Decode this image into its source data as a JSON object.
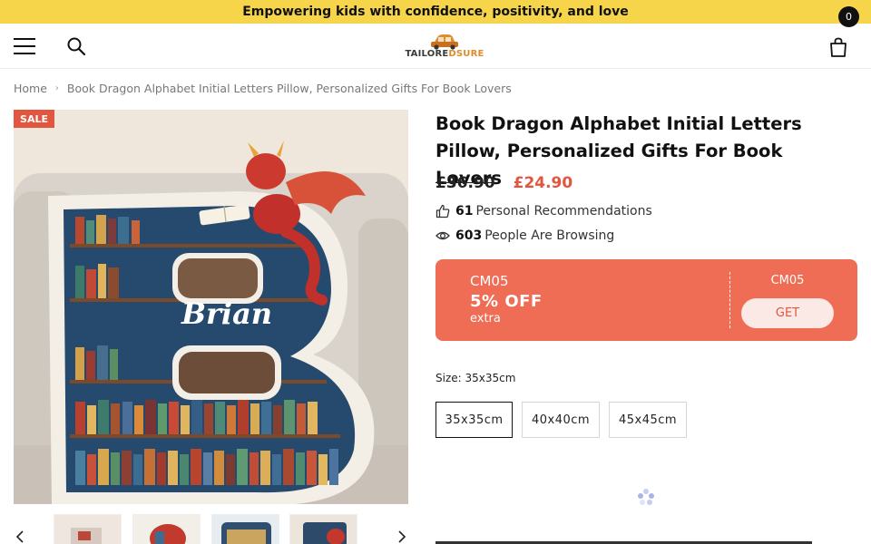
{
  "announcement": "Empowering kids with confidence, positivity, and love",
  "header": {
    "logo_prefix": "TAILORE",
    "logo_suffix": "DSURE",
    "cart_count": "0"
  },
  "breadcrumb": {
    "home": "Home",
    "current": "Book Dragon Alphabet Initial Letters Pillow, Personalized Gifts For Book Lovers"
  },
  "gallery": {
    "badge": "SALE",
    "personalized_name": "Brian"
  },
  "product": {
    "title": "Book Dragon Alphabet Initial Letters Pillow, Personalized Gifts For Book Lovers",
    "old_price": "£36.90",
    "new_price": "£24.90",
    "recommend_count": "61",
    "recommend_text": "Personal Recommendations",
    "browsing_count": "603",
    "browsing_text": "People Are Browsing"
  },
  "coupon": {
    "code": "CM05",
    "discount": "5% OFF",
    "extra": "extra",
    "code_right": "CM05",
    "button": "GET"
  },
  "size": {
    "label": "Size: 35x35cm",
    "options": [
      "35x35cm",
      "40x40cm",
      "45x45cm"
    ],
    "selected": "35x35cm"
  },
  "colors": {
    "announcement_bg": "#f6d54a",
    "sale_red": "#e2553f",
    "coupon_bg": "#ef6c55"
  }
}
